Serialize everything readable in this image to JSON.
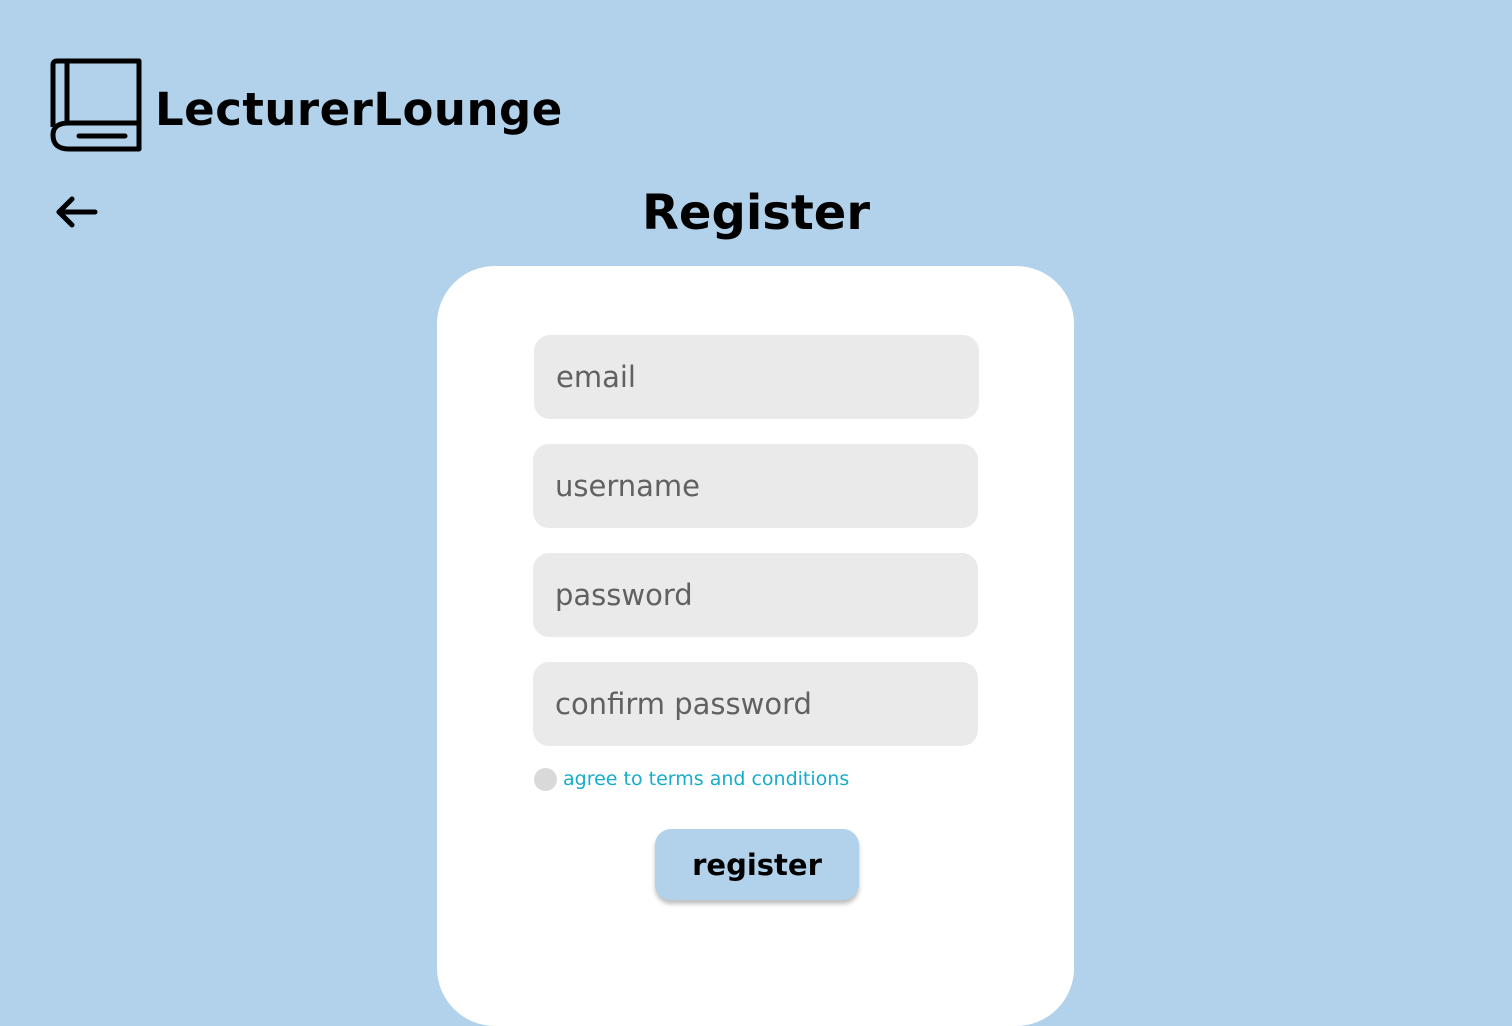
{
  "brand": {
    "name": "LecturerLounge",
    "logo_icon": "book-icon"
  },
  "nav": {
    "back_icon": "arrow-left-icon"
  },
  "page": {
    "title": "Register"
  },
  "form": {
    "email_placeholder": "email",
    "username_placeholder": "username",
    "password_placeholder": "password",
    "confirm_password_placeholder": "confirm password",
    "terms_label": "agree to terms and conditions",
    "terms_checked": false,
    "register_label": "register"
  },
  "colors": {
    "background": "#b2d2eb",
    "card": "#ffffff",
    "field": "#eaeaea",
    "link": "#17acc9",
    "button": "#b2d2eb"
  }
}
